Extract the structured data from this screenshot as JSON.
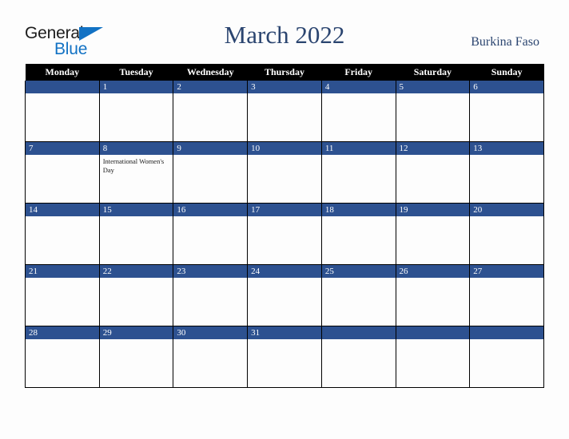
{
  "brand": {
    "name_part1": "General",
    "name_part2": "Blue",
    "triangle_icon": "blue-triangle",
    "accent_color": "#1272c4"
  },
  "header": {
    "title": "March 2022",
    "country": "Burkina Faso",
    "title_color": "#2b4570"
  },
  "calendar": {
    "weekdays": [
      "Monday",
      "Tuesday",
      "Wednesday",
      "Thursday",
      "Friday",
      "Saturday",
      "Sunday"
    ],
    "header_bg": "#000000",
    "daybar_bg": "#2d5190",
    "weeks": [
      [
        {
          "date": "",
          "events": []
        },
        {
          "date": "1",
          "events": []
        },
        {
          "date": "2",
          "events": []
        },
        {
          "date": "3",
          "events": []
        },
        {
          "date": "4",
          "events": []
        },
        {
          "date": "5",
          "events": []
        },
        {
          "date": "6",
          "events": []
        }
      ],
      [
        {
          "date": "7",
          "events": []
        },
        {
          "date": "8",
          "events": [
            "International Women's Day"
          ]
        },
        {
          "date": "9",
          "events": []
        },
        {
          "date": "10",
          "events": []
        },
        {
          "date": "11",
          "events": []
        },
        {
          "date": "12",
          "events": []
        },
        {
          "date": "13",
          "events": []
        }
      ],
      [
        {
          "date": "14",
          "events": []
        },
        {
          "date": "15",
          "events": []
        },
        {
          "date": "16",
          "events": []
        },
        {
          "date": "17",
          "events": []
        },
        {
          "date": "18",
          "events": []
        },
        {
          "date": "19",
          "events": []
        },
        {
          "date": "20",
          "events": []
        }
      ],
      [
        {
          "date": "21",
          "events": []
        },
        {
          "date": "22",
          "events": []
        },
        {
          "date": "23",
          "events": []
        },
        {
          "date": "24",
          "events": []
        },
        {
          "date": "25",
          "events": []
        },
        {
          "date": "26",
          "events": []
        },
        {
          "date": "27",
          "events": []
        }
      ],
      [
        {
          "date": "28",
          "events": []
        },
        {
          "date": "29",
          "events": []
        },
        {
          "date": "30",
          "events": []
        },
        {
          "date": "31",
          "events": []
        },
        {
          "date": "",
          "events": []
        },
        {
          "date": "",
          "events": []
        },
        {
          "date": "",
          "events": []
        }
      ]
    ]
  }
}
